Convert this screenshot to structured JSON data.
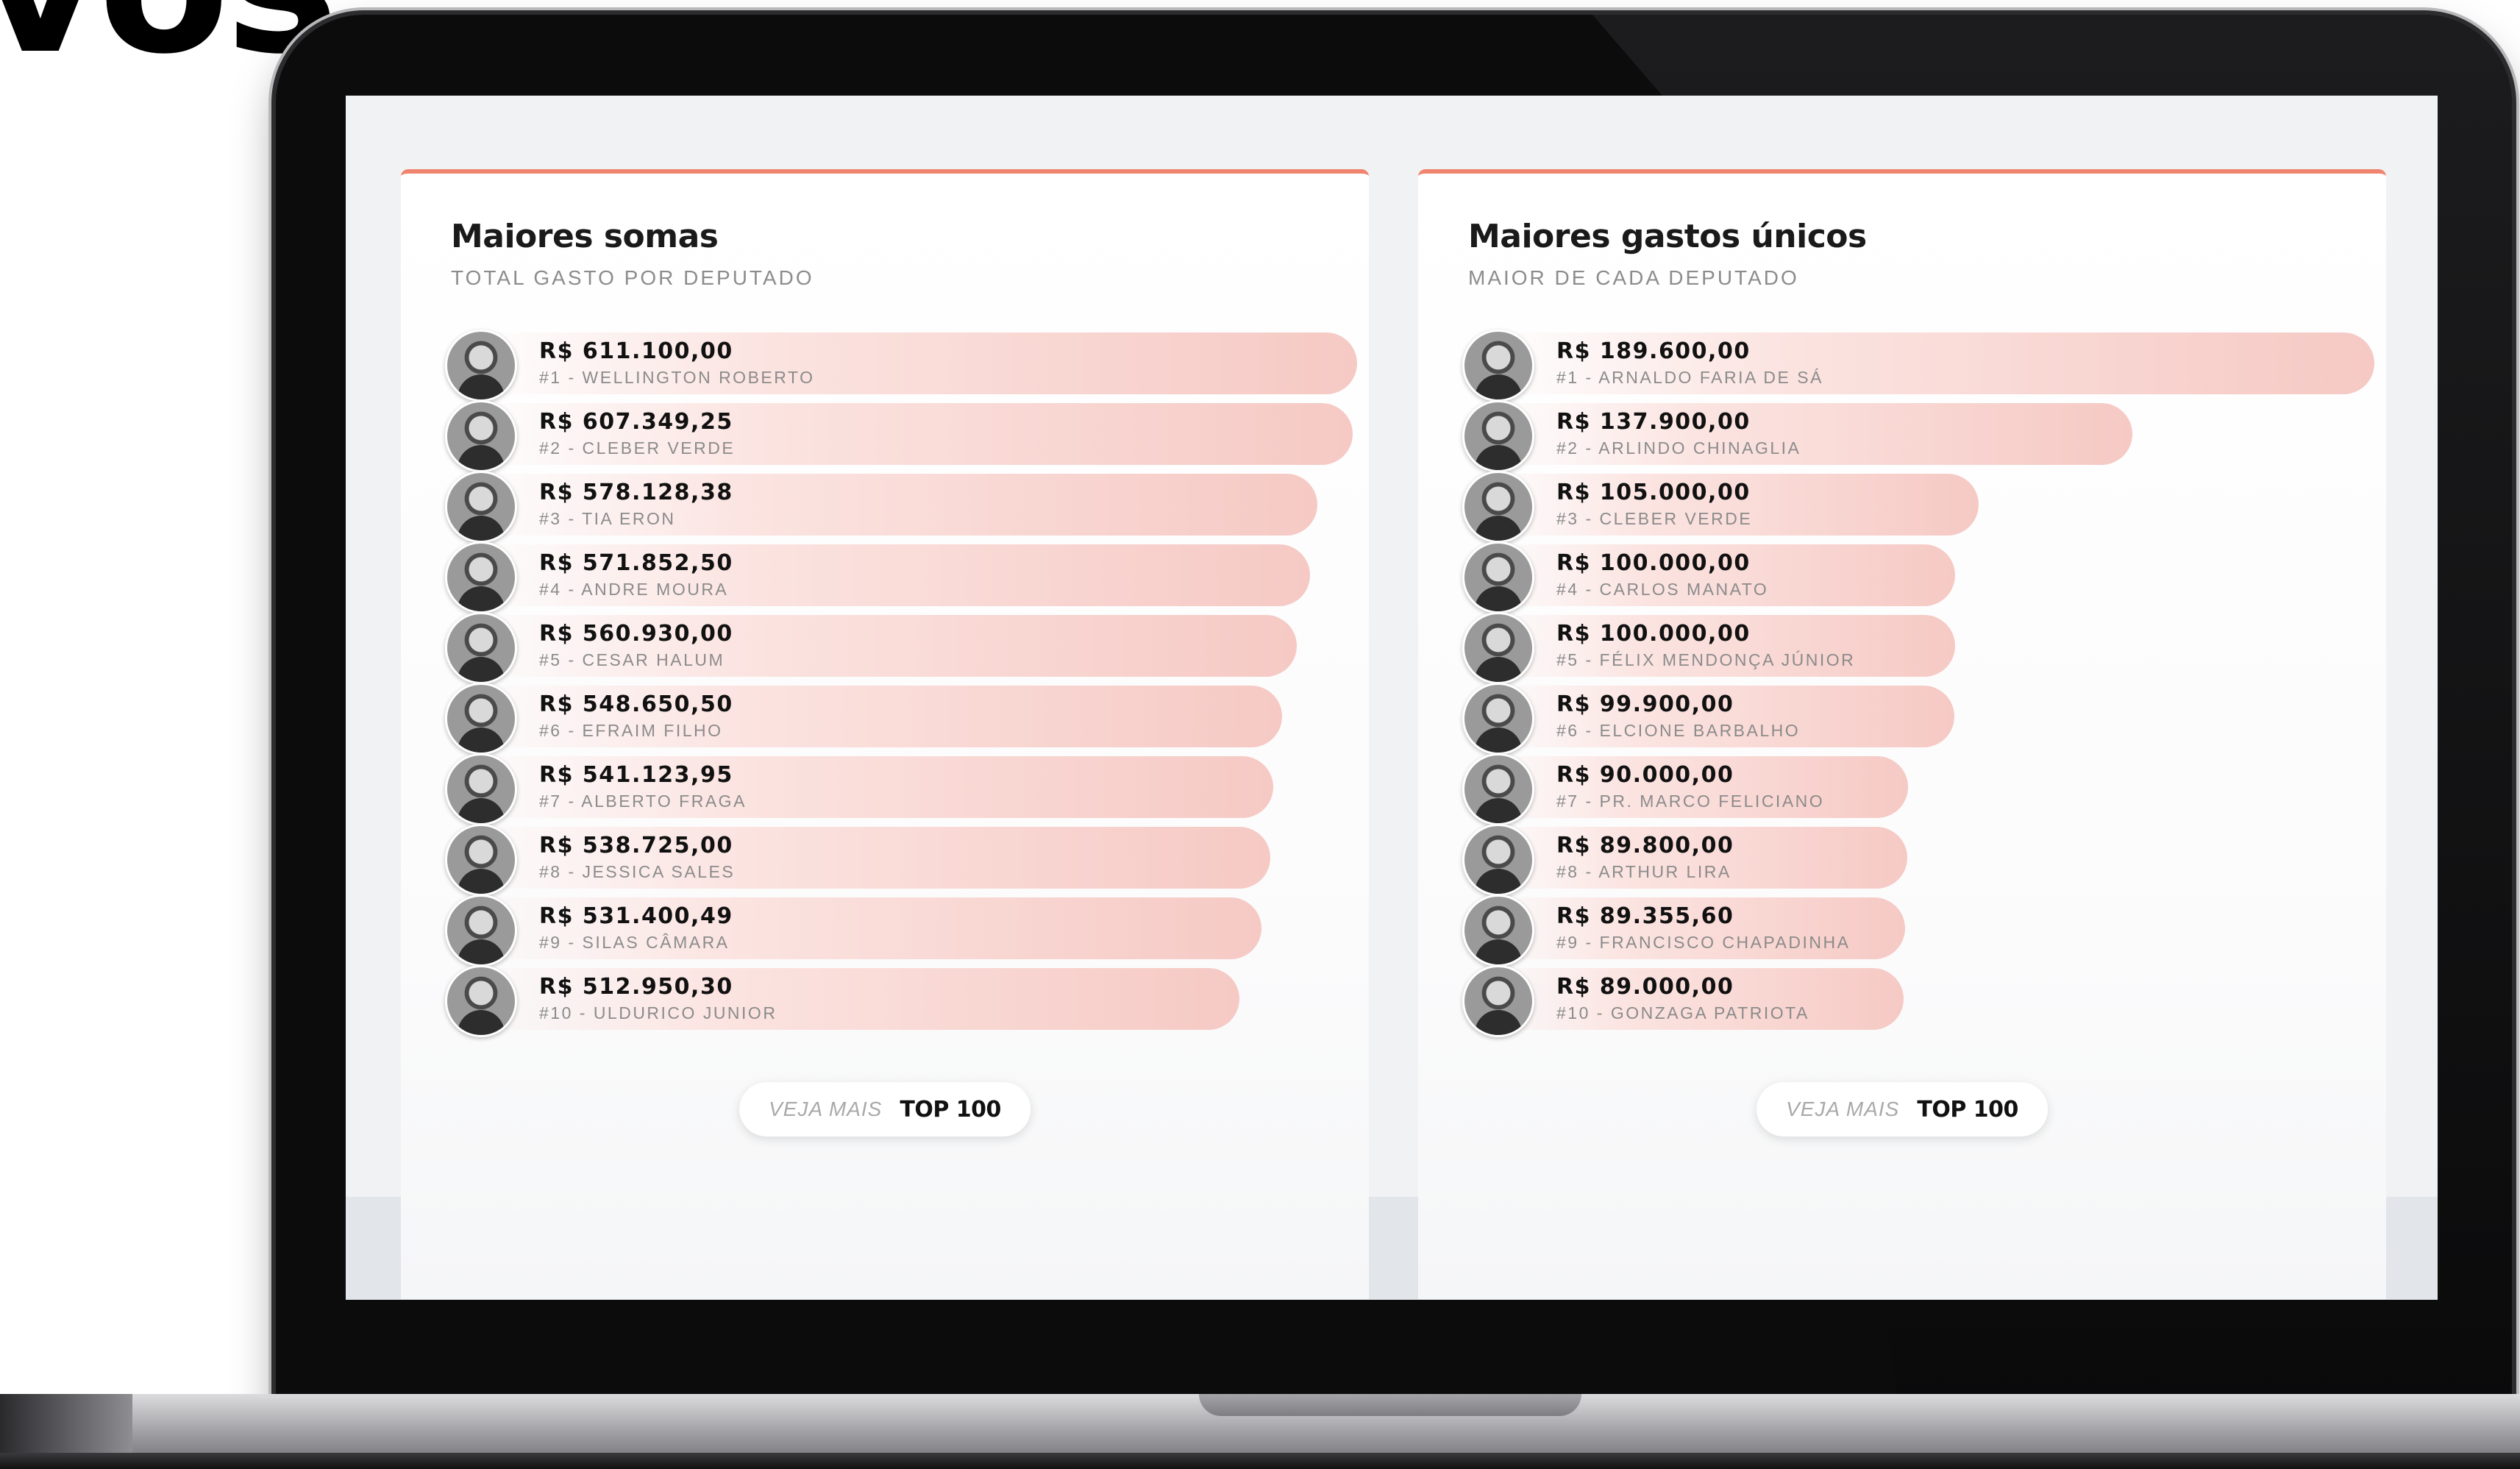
{
  "background_text": "vos",
  "panels": [
    {
      "title": "Maiores somas",
      "subtitle": "TOTAL GASTO POR DEPUTADO",
      "rows": [
        {
          "amount": "R$ 611.100,00",
          "label": "#1 - WELLINGTON ROBERTO",
          "value": 611100.0
        },
        {
          "amount": "R$ 607.349,25",
          "label": "#2 - CLEBER VERDE",
          "value": 607349.25
        },
        {
          "amount": "R$ 578.128,38",
          "label": "#3 - TIA ERON",
          "value": 578128.38
        },
        {
          "amount": "R$ 571.852,50",
          "label": "#4 - ANDRE MOURA",
          "value": 571852.5
        },
        {
          "amount": "R$ 560.930,00",
          "label": "#5 - CESAR HALUM",
          "value": 560930.0
        },
        {
          "amount": "R$ 548.650,50",
          "label": "#6 - EFRAIM FILHO",
          "value": 548650.5
        },
        {
          "amount": "R$ 541.123,95",
          "label": "#7 - ALBERTO FRAGA",
          "value": 541123.95
        },
        {
          "amount": "R$ 538.725,00",
          "label": "#8 - JESSICA SALES",
          "value": 538725.0
        },
        {
          "amount": "R$ 531.400,49",
          "label": "#9 - SILAS CÂMARA",
          "value": 531400.49
        },
        {
          "amount": "R$ 512.950,30",
          "label": "#10 - ULDURICO JUNIOR",
          "value": 512950.3
        }
      ],
      "button": {
        "veja": "VEJA MAIS",
        "top": "TOP 100"
      }
    },
    {
      "title": "Maiores gastos únicos",
      "subtitle": "MAIOR DE CADA DEPUTADO",
      "rows": [
        {
          "amount": "R$ 189.600,00",
          "label": "#1 - ARNALDO FARIA DE SÁ",
          "value": 189600.0
        },
        {
          "amount": "R$ 137.900,00",
          "label": "#2 - ARLINDO CHINAGLIA",
          "value": 137900.0
        },
        {
          "amount": "R$ 105.000,00",
          "label": "#3 - CLEBER VERDE",
          "value": 105000.0
        },
        {
          "amount": "R$ 100.000,00",
          "label": "#4 - CARLOS MANATO",
          "value": 100000.0
        },
        {
          "amount": "R$ 100.000,00",
          "label": "#5 - FÉLIX MENDONÇA JÚNIOR",
          "value": 100000.0
        },
        {
          "amount": "R$ 99.900,00",
          "label": "#6 - ELCIONE BARBALHO",
          "value": 99900.0
        },
        {
          "amount": "R$ 90.000,00",
          "label": "#7 - PR. MARCO FELICIANO",
          "value": 90000.0
        },
        {
          "amount": "R$ 89.800,00",
          "label": "#8 - ARTHUR LIRA",
          "value": 89800.0
        },
        {
          "amount": "R$ 89.355,60",
          "label": "#9 - FRANCISCO CHAPADINHA",
          "value": 89355.6
        },
        {
          "amount": "R$ 89.000,00",
          "label": "#10 - GONZAGA PATRIOTA",
          "value": 89000.0
        }
      ],
      "button": {
        "veja": "VEJA MAIS",
        "top": "TOP 100"
      }
    }
  ],
  "colors": {
    "accent": "#f0846e",
    "bar_end": "#f6c9c4",
    "screen_bg": "#f1f2f4"
  }
}
